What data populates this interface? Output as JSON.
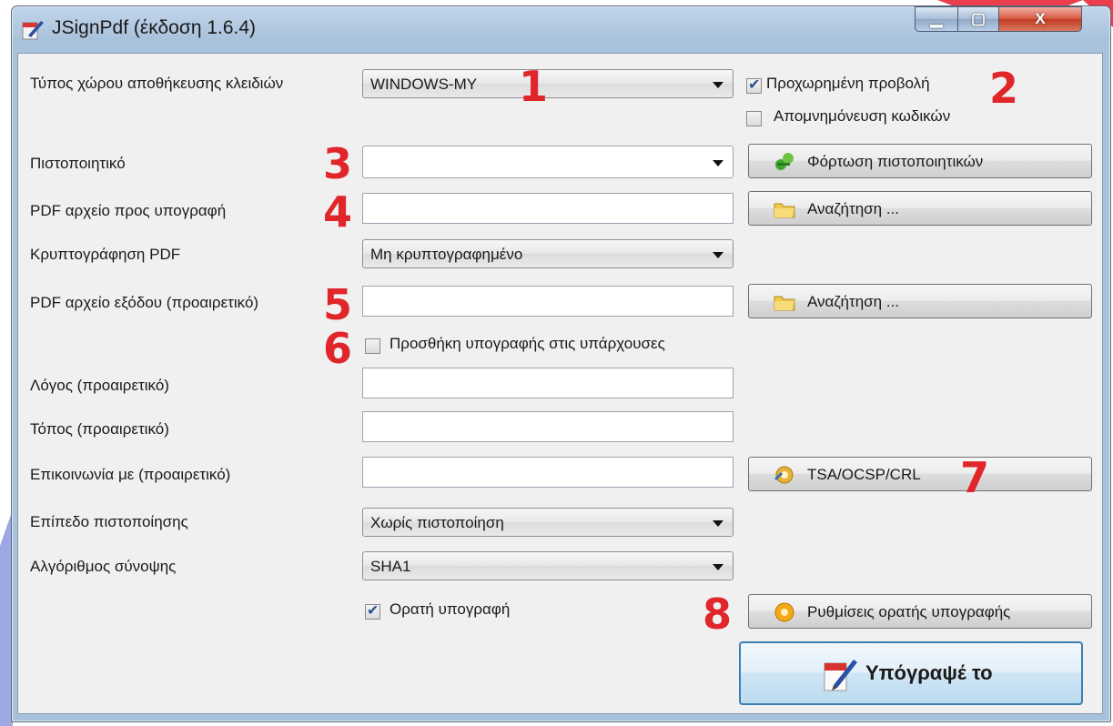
{
  "window": {
    "title": "JSignPdf (έκδοση 1.6.4)",
    "controls": {
      "minimize": "▁",
      "maximize": "▢",
      "close": "X"
    }
  },
  "form": {
    "keystore_label": "Τύπος χώρου αποθήκευσης κλειδιών",
    "keystore_value": "WINDOWS-MY",
    "advanced_view_label": "Προχωρημένη προβολή",
    "advanced_view_checked": true,
    "remember_passwords_label": "Απομνημόνευση κωδικών",
    "remember_passwords_checked": false,
    "certificate_label": "Πιστοποιητικό",
    "certificate_value": "",
    "load_certificates_label": "Φόρτωση πιστοποιητικών",
    "input_pdf_label": "PDF αρχείο προς υπογραφή",
    "input_pdf_value": "",
    "browse_label": "Αναζήτηση ...",
    "encryption_label": "Κρυπτογράφηση PDF",
    "encryption_value": "Μη κρυπτογραφημένο",
    "output_pdf_label": "PDF αρχείο εξόδου (προαιρετικό)",
    "output_pdf_value": "",
    "append_signature_label": "Προσθήκη υπογραφής στις υπάρχουσες",
    "append_signature_checked": false,
    "reason_label": "Λόγος (προαιρετικό)",
    "location_label": "Τόπος (προαιρετικό)",
    "contact_label": "Επικοινωνία με (προαιρετικό)",
    "tsa_label": "TSA/OCSP/CRL",
    "cert_level_label": "Επίπεδο πιστοποίησης",
    "cert_level_value": "Χωρίς πιστοποίηση",
    "hash_alg_label": "Αλγόριθμος σύνοψης",
    "hash_alg_value": "SHA1",
    "visible_signature_label": "Ορατή υπογραφή",
    "visible_signature_checked": true,
    "visible_signature_settings_label": "Ρυθμίσεις ορατής υπογραφής",
    "sign_button_label": "Υπόγραψέ το"
  },
  "callouts": [
    "1",
    "2",
    "3",
    "4",
    "5",
    "6",
    "7",
    "8"
  ],
  "colors": {
    "callout": "#e0262a",
    "window_frame": "#a9c2dc",
    "client": "#f0f0f0"
  }
}
